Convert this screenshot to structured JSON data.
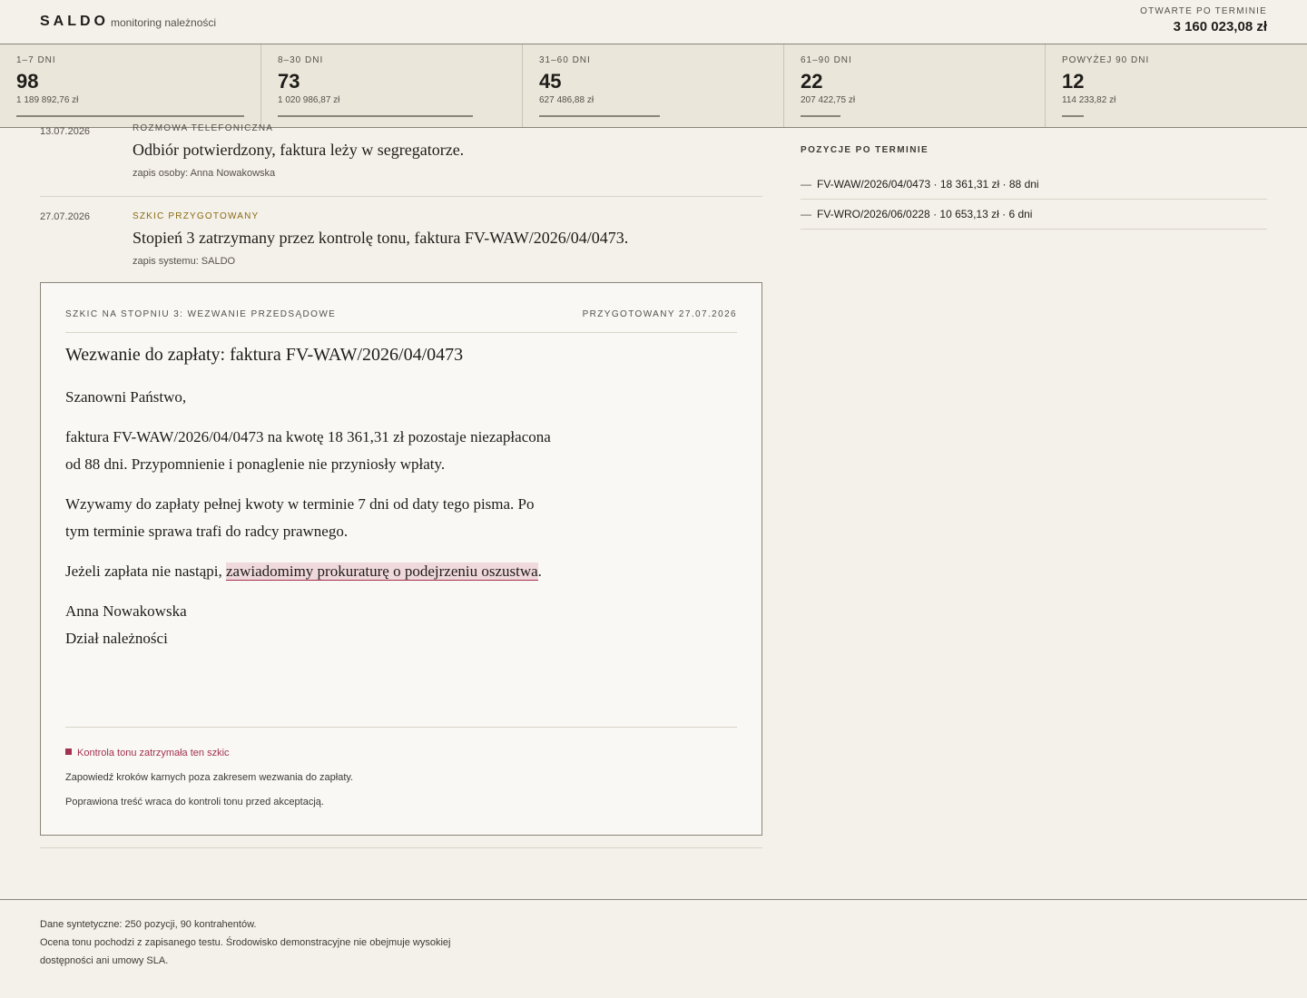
{
  "header": {
    "brand": "SALDO",
    "subtitle": "monitoring należności",
    "open_label": "OTWARTE PO TERMINIE",
    "open_value": "3 160 023,08 zł"
  },
  "buckets": [
    {
      "label": "1–7 DNI",
      "count": "98",
      "amount": "1 189 892,76 zł",
      "share": 0.377
    },
    {
      "label": "8–30 DNI",
      "count": "73",
      "amount": "1 020 986,87 zł",
      "share": 0.323
    },
    {
      "label": "31–60 DNI",
      "count": "45",
      "amount": "627 486,88 zł",
      "share": 0.199
    },
    {
      "label": "61–90 DNI",
      "count": "22",
      "amount": "207 422,75 zł",
      "share": 0.066
    },
    {
      "label": "POWYŻEJ 90 DNI",
      "count": "12",
      "amount": "114 233,82 zł",
      "share": 0.036
    }
  ],
  "timeline": [
    {
      "date": "13.07.2026",
      "type": "ROZMOWA TELEFONICZNA",
      "text": "Odbiór potwierdzony, faktura leży w segregatorze.",
      "note": "zapis osoby: Anna Nowakowska"
    },
    {
      "date": "27.07.2026",
      "type": "SZKIC PRZYGOTOWANY",
      "text": "Stopień 3 zatrzymany przez kontrolę tonu, faktura FV-WAW/2026/04/0473.",
      "note": "zapis systemu: SALDO"
    }
  ],
  "draft": {
    "stage_label": "SZKIC NA STOPNIU 3: WEZWANIE PRZEDSĄDOWE",
    "prepared_label": "PRZYGOTOWANY 27.07.2026",
    "title": "Wezwanie do zapłaty: faktura FV-WAW/2026/04/0473",
    "greeting": "Szanowni Państwo,",
    "para1": "faktura FV-WAW/2026/04/0473 na kwotę 18 361,31 zł pozostaje niezapłacona od 88 dni. Przypomnienie i ponaglenie nie przyniosły wpłaty.",
    "para2": "Wzywamy do zapłaty pełnej kwoty w terminie 7 dni od daty tego pisma. Po tym terminie sprawa trafi do radcy prawnego.",
    "para3_before": "Jeżeli zapłata nie nastąpi, ",
    "para3_flagged": "zawiadomimy prokuraturę o podejrzeniu oszustwa",
    "para3_after": ".",
    "signature_name": "Anna Nowakowska",
    "signature_dept": "Dział należności",
    "tone_title": "Kontrola tonu zatrzymała ten szkic",
    "tone_reason": "Zapowiedź kroków karnych poza zakresem wezwania do zapłaty.",
    "tone_next": "Poprawiona treść wraca do kontroli tonu przed akceptacją."
  },
  "side": {
    "title": "POZYCJE PO TERMINIE",
    "items": [
      "FV-WAW/2026/04/0473 · 18 361,31 zł · 88 dni",
      "FV-WRO/2026/06/0228 · 10 653,13 zł · 6 dni"
    ]
  },
  "footer": {
    "line1": "Dane syntetyczne: 250 pozycji, 90 kontrahentów.",
    "line2": "Ocena tonu pochodzi z zapisanego testu. Środowisko demonstracyjne nie obejmuje wysokiej dostępności ani umowy SLA."
  },
  "colors": {
    "accent_warning": "#a3324f",
    "accent_gold": "#8a6a12",
    "background": "#f4f1ea"
  }
}
